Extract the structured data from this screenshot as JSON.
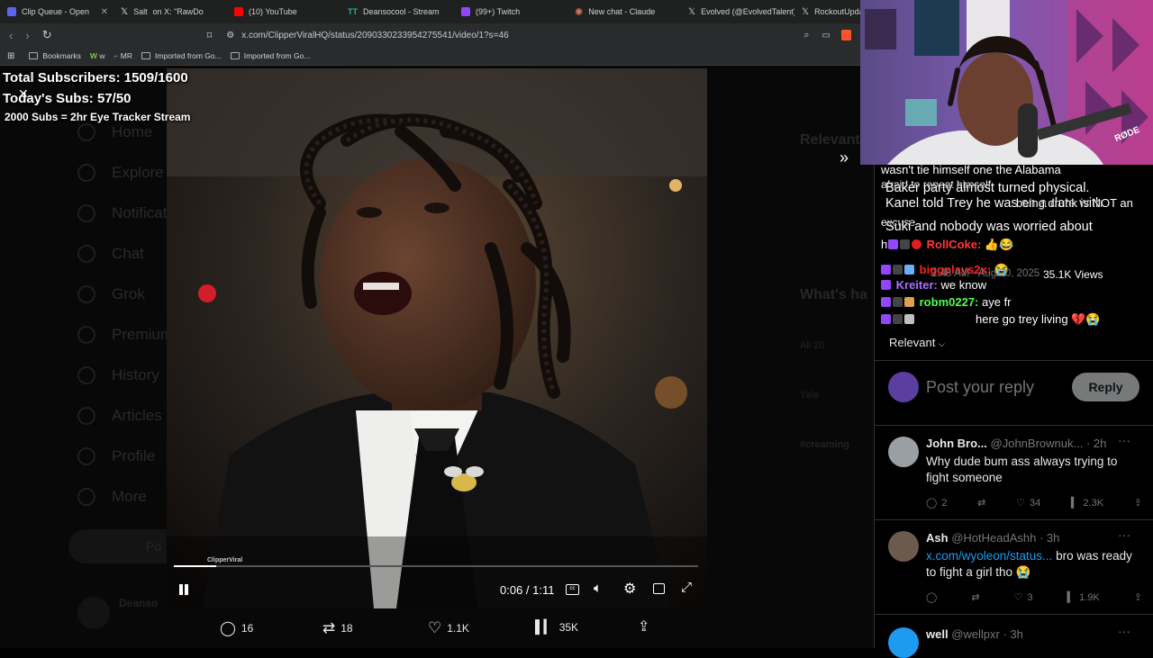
{
  "tabs": [
    {
      "label": "Clip Queue - Open",
      "color": "#5865f2"
    },
    {
      "label": "Salt",
      "color": "#6b6bf0"
    },
    {
      "label": "on X: \"RawDo",
      "color": "#000000"
    },
    {
      "label": "(10) YouTube",
      "color": "#ff0000"
    },
    {
      "label": "Deansocool - Stream",
      "color": "#24b3a6"
    },
    {
      "label": "(99+) Twitch",
      "color": "#9146ff"
    },
    {
      "label": "New chat - Claude",
      "color": "#d97757"
    },
    {
      "label": "Evolved (@EvolvedTalent)",
      "color": "#000000"
    },
    {
      "label": "RockoutUpdat",
      "color": "#000000"
    }
  ],
  "address": {
    "url": "x.com/ClipperViralHQ/status/2090330233954275541/video/1?s=46"
  },
  "bookmarks": {
    "bookmarks_label": "Bookmarks",
    "w_label": "w",
    "mr_label": "MR",
    "imported1": "Imported from Go...",
    "imported2": "Imported from Go..."
  },
  "overlay": {
    "total_subs": "Total Subscribers: 1509/1600",
    "today_subs": "Today's Subs: 57/50",
    "goal": "2000 Subs = 2hr Eye Tracker Stream",
    "watermark": "ClipperViral"
  },
  "sidebar_bg": [
    "Home",
    "Explore",
    "Notifications",
    "Chat",
    "Grok",
    "Premium",
    "History",
    "Articles",
    "Profile",
    "More"
  ],
  "bg_misc": {
    "relevant": "Relevant",
    "whats_happening": "What's ha",
    "post_bg": "Po",
    "trend1": "All 20",
    "trend2": "Yale",
    "trend3": "#creaming",
    "bottom_user": "Deanso"
  },
  "video": {
    "time": "0:06 / 1:11",
    "progress_fraction": 0.08
  },
  "engagement": {
    "replies": "16",
    "reposts": "18",
    "likes": "1.1K",
    "views": "35K"
  },
  "chat": {
    "garbled_lines": [
      "wasn't tie himself one the Alabama",
      "afraid to repeat himself",
      "Baker party almost turned physical.",
      "Kanel told Trey he was on a date with",
      "being drunk is NOT an",
      "excuse",
      "Suki and nobody was worried about",
      "hi"
    ],
    "messages": [
      {
        "user": "RollCoke:",
        "user_color": "#ff3b3b",
        "text": "👍😂"
      },
      {
        "user": "biggplays2x:",
        "user_color": "#ff2020",
        "text": "😭"
      },
      {
        "user": "Kreiter:",
        "user_color": "#a970ff",
        "text": "we know"
      },
      {
        "user": "robm0227:",
        "user_color": "#4cff4c",
        "text": "aye fr"
      },
      {
        "user": "",
        "user_color": "#ffffff",
        "text": "here go trey living 💔😭"
      }
    ],
    "timestamp_bg": "2:48 AM · Aug 20, 2025",
    "views_bg": "35.1K Views"
  },
  "replies_panel": {
    "sort": "Relevant",
    "post_placeholder": "Post your reply",
    "reply_button": "Reply",
    "replies": [
      {
        "name": "John Bro...",
        "handle": "@JohnBrownuk...",
        "time": "· 2h",
        "text": "Why dude bum ass always trying to fight someone",
        "link": "",
        "counts": {
          "replies": "2",
          "reposts": "",
          "likes": "34",
          "views": "2.3K"
        }
      },
      {
        "name": "Ash",
        "handle": "@HotHeadAshh",
        "time": "· 3h",
        "link": "x.com/wyoleon/status...",
        "text": "bro was ready to fight a girl tho 😭",
        "counts": {
          "replies": "",
          "reposts": "",
          "likes": "3",
          "views": "1.9K"
        }
      },
      {
        "name": "well",
        "handle": "@wellpxr",
        "time": "· 3h",
        "link": "",
        "text": "",
        "counts": {
          "replies": "",
          "reposts": "",
          "likes": "",
          "views": ""
        }
      }
    ]
  },
  "webcam": {
    "mic_brand": "RØDE"
  },
  "colors": {
    "x_blue": "#1d9bf0",
    "muted": "#71767b",
    "bg": "#000000"
  }
}
